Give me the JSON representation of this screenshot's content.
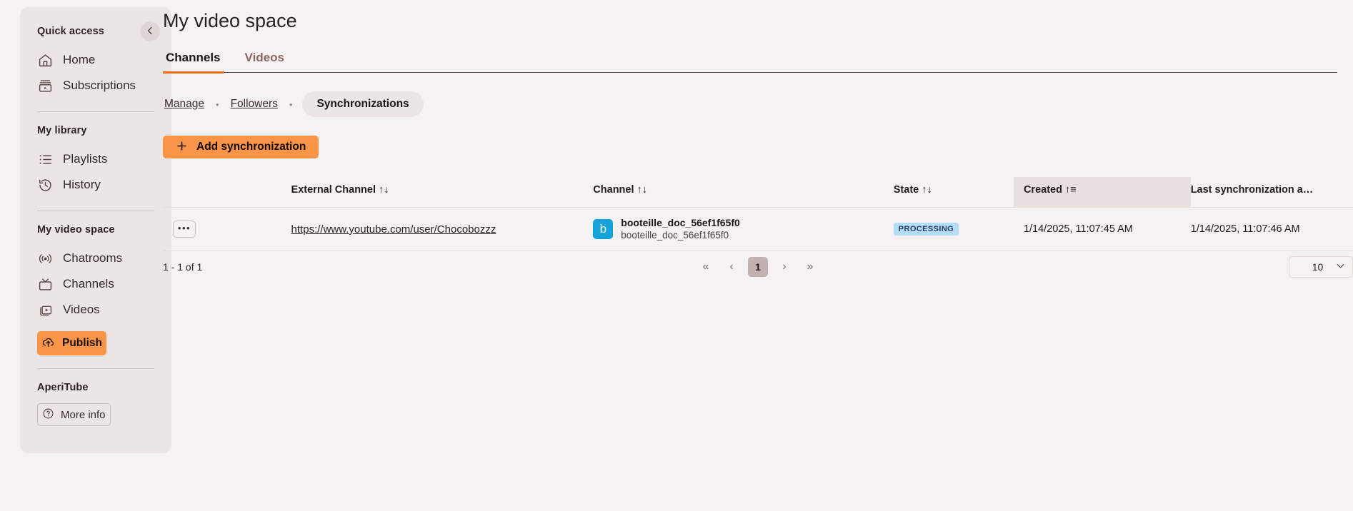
{
  "sidebar": {
    "collapse_icon": "chevron-left-icon",
    "groups": [
      {
        "title": "Quick access",
        "items": [
          {
            "label": "Home",
            "icon": "home-icon"
          },
          {
            "label": "Subscriptions",
            "icon": "subscriptions-icon"
          }
        ]
      },
      {
        "title": "My library",
        "items": [
          {
            "label": "Playlists",
            "icon": "playlist-icon"
          },
          {
            "label": "History",
            "icon": "history-icon"
          }
        ]
      },
      {
        "title": "My video space",
        "items": [
          {
            "label": "Chatrooms",
            "icon": "broadcast-icon"
          },
          {
            "label": "Channels",
            "icon": "tv-icon"
          },
          {
            "label": "Videos",
            "icon": "videos-icon"
          }
        ]
      }
    ],
    "publish_label": "Publish",
    "publish_icon": "cloud-upload-icon",
    "footer_title": "AperiTube",
    "more_info_label": "More info",
    "more_info_icon": "question-circle-icon"
  },
  "header": {
    "title": "My video space",
    "tabs": [
      {
        "label": "Channels",
        "active": true
      },
      {
        "label": "Videos",
        "active": false
      }
    ]
  },
  "subnav": {
    "links": [
      "Manage",
      "Followers"
    ],
    "separator": "•",
    "active_pill": "Synchronizations"
  },
  "toolbar": {
    "add_sync_label": "Add synchronization",
    "add_sync_icon": "plus-icon"
  },
  "table": {
    "columns": [
      {
        "label": "",
        "key": "actions"
      },
      {
        "label": "External Channel",
        "sort": "↑↓"
      },
      {
        "label": "Channel",
        "sort": "↑↓"
      },
      {
        "label": "State",
        "sort": "↑↓"
      },
      {
        "label": "Created",
        "sort": "↑≡",
        "sorted": true
      },
      {
        "label": "Last synchronization a…",
        "sort": ""
      }
    ],
    "rows": [
      {
        "kebab": "•••",
        "external_channel": "https://www.youtube.com/user/Chocobozzz",
        "channel_avatar_letter": "b",
        "channel_name": "booteille_doc_56ef1f65f0",
        "channel_handle": "booteille_doc_56ef1f65f0",
        "state": "PROCESSING",
        "created": "1/14/2025, 11:07:45 AM",
        "last_sync": "1/14/2025, 11:07:46 AM"
      }
    ]
  },
  "footer": {
    "range": "1 - 1 of 1",
    "first_label": "«",
    "prev_label": "‹",
    "current_page": "1",
    "next_label": "›",
    "last_label": "»",
    "page_size": "10",
    "page_size_caret": "chevron-down-icon"
  },
  "colors": {
    "accent": "#fa9446",
    "tab_underline": "#ec6a10",
    "sidebar_bg": "#ece5e5",
    "page_bg": "#f4f2f2",
    "avatar": "#16a3d8",
    "badge_bg": "#b4ddf7"
  }
}
